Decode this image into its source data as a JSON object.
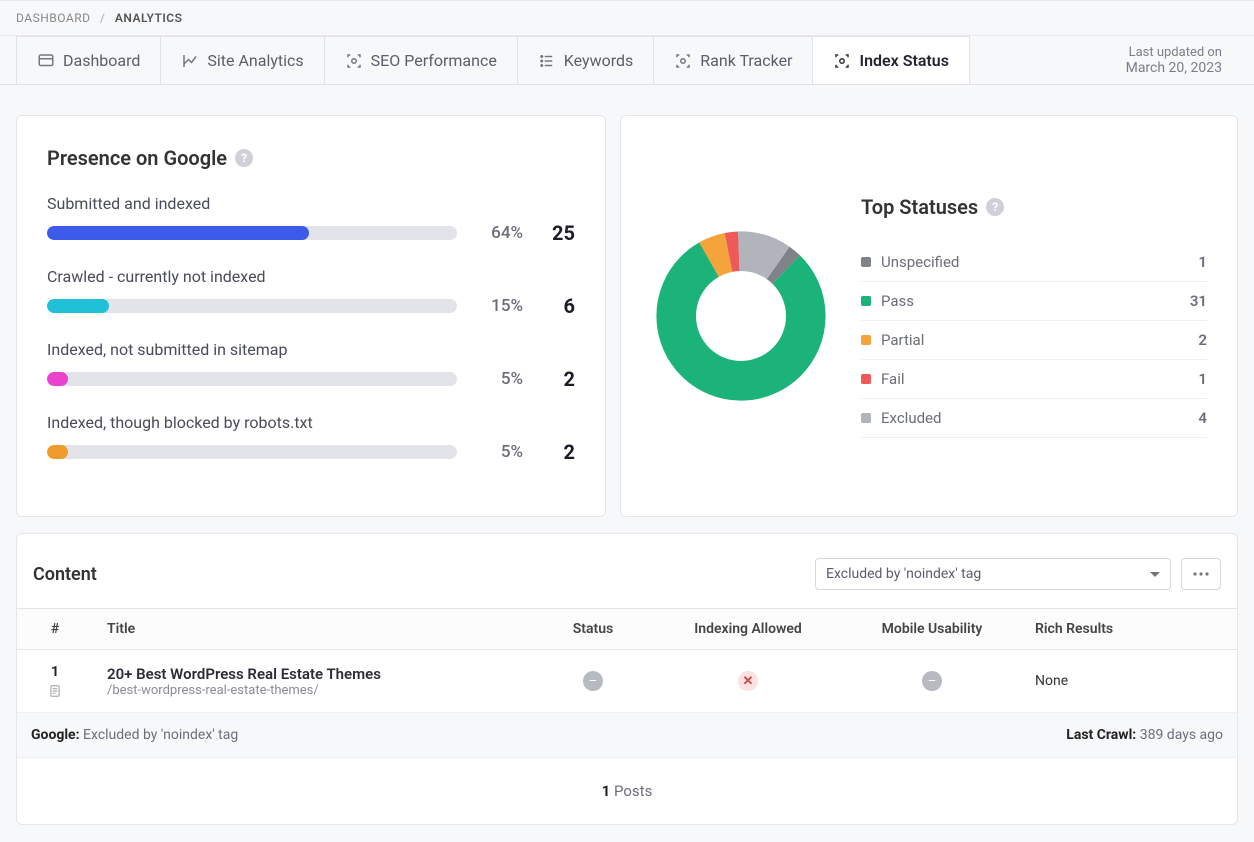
{
  "breadcrumb": {
    "dashboard": "DASHBOARD",
    "sep": "/",
    "current": "ANALYTICS"
  },
  "tabs": {
    "dashboard": "Dashboard",
    "site_analytics": "Site Analytics",
    "seo_performance": "SEO Performance",
    "keywords": "Keywords",
    "rank_tracker": "Rank Tracker",
    "index_status": "Index Status"
  },
  "last_updated": {
    "label": "Last updated on",
    "date": "March 20, 2023"
  },
  "presence": {
    "title": "Presence on Google",
    "items": [
      {
        "label": "Submitted and indexed",
        "pct": "64%",
        "pct_num": 64,
        "val": "25",
        "color": "#3b5be8"
      },
      {
        "label": "Crawled - currently not indexed",
        "pct": "15%",
        "pct_num": 15,
        "val": "6",
        "color": "#20c0d6"
      },
      {
        "label": "Indexed, not submitted in sitemap",
        "pct": "5%",
        "pct_num": 5,
        "val": "2",
        "color": "#ea41d1"
      },
      {
        "label": "Indexed, though blocked by robots.txt",
        "pct": "5%",
        "pct_num": 5,
        "val": "2",
        "color": "#f09b2d"
      }
    ]
  },
  "top_statuses": {
    "title": "Top Statuses",
    "items": [
      {
        "name": "Unspecified",
        "count": "1",
        "num": 1,
        "color": "#808289"
      },
      {
        "name": "Pass",
        "count": "31",
        "num": 31,
        "color": "#1cb37a"
      },
      {
        "name": "Partial",
        "count": "2",
        "num": 2,
        "color": "#f4a43a"
      },
      {
        "name": "Fail",
        "count": "1",
        "num": 1,
        "color": "#ee5a5a"
      },
      {
        "name": "Excluded",
        "count": "4",
        "num": 4,
        "color": "#b2b4bc"
      }
    ]
  },
  "chart_data": {
    "type": "pie",
    "title": "Top Statuses",
    "series": [
      {
        "name": "Unspecified",
        "value": 1
      },
      {
        "name": "Pass",
        "value": 31
      },
      {
        "name": "Partial",
        "value": 2
      },
      {
        "name": "Fail",
        "value": 1
      },
      {
        "name": "Excluded",
        "value": 4
      }
    ]
  },
  "content": {
    "title": "Content",
    "filter": "Excluded by 'noindex' tag",
    "columns": {
      "idx": "#",
      "title": "Title",
      "status": "Status",
      "indexing": "Indexing Allowed",
      "mobile": "Mobile Usability",
      "rich": "Rich Results"
    },
    "row": {
      "idx": "1",
      "title": "20+ Best WordPress Real Estate Themes",
      "path": "/best-wordpress-real-estate-themes/",
      "rich": "None"
    },
    "footer": {
      "google_label": "Google:",
      "google_value": "Excluded by 'noindex' tag",
      "last_crawl_label": "Last Crawl:",
      "last_crawl_value": "389 days ago"
    },
    "posts": {
      "count": "1",
      "label": "Posts"
    }
  }
}
